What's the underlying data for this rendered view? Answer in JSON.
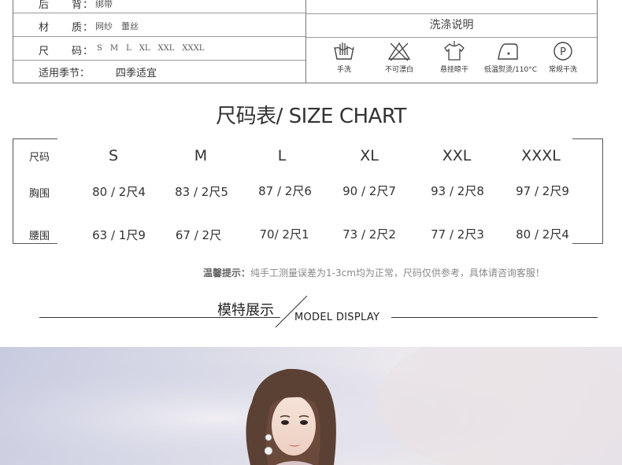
{
  "info": {
    "rows": [
      {
        "label": "后　　背：",
        "value": "绑带"
      },
      {
        "label": "材　　质：",
        "value": "网纱　蕾丝"
      },
      {
        "label": "尺　　码：",
        "value": "S  M  L  XL  XXL  XXXL"
      },
      {
        "label": "适用季节：",
        "value": "四季适宜"
      }
    ],
    "wash_title": "洗涤说明",
    "wash_items": [
      {
        "icon": "hand-wash-icon",
        "label": "手洗"
      },
      {
        "icon": "no-bleach-icon",
        "label": "不可漂白"
      },
      {
        "icon": "hang-dry-icon",
        "label": "悬挂晾干"
      },
      {
        "icon": "low-iron-icon",
        "label": "低温熨烫/110°C"
      },
      {
        "icon": "dry-clean-icon",
        "label": "常规干洗"
      }
    ]
  },
  "size_chart": {
    "title": "尺码表/ SIZE CHART",
    "row_header": "尺码",
    "sizes": [
      "S",
      "M",
      "L",
      "XL",
      "XXL",
      "XXXL"
    ],
    "rows": [
      {
        "label": "胸围",
        "values": [
          "80 / 2尺4",
          "83 / 2尺5",
          "87 / 2尺6",
          "90 / 2尺7",
          "93 / 2尺8",
          "97 / 2尺9"
        ]
      },
      {
        "label": "腰围",
        "values": [
          "63 / 1尺9",
          "67 / 2尺",
          "70/ 2尺1",
          "73 / 2尺2",
          "77 / 2尺3",
          "80 / 2尺4"
        ]
      }
    ]
  },
  "tip": {
    "prefix": "温馨提示：",
    "text": "纯手工测量误差为1-3cm均为正常，尺码仅供参考，具体请咨询客服！"
  },
  "model_display": {
    "zh": "模特展示",
    "en": "MODEL DISPLAY"
  }
}
